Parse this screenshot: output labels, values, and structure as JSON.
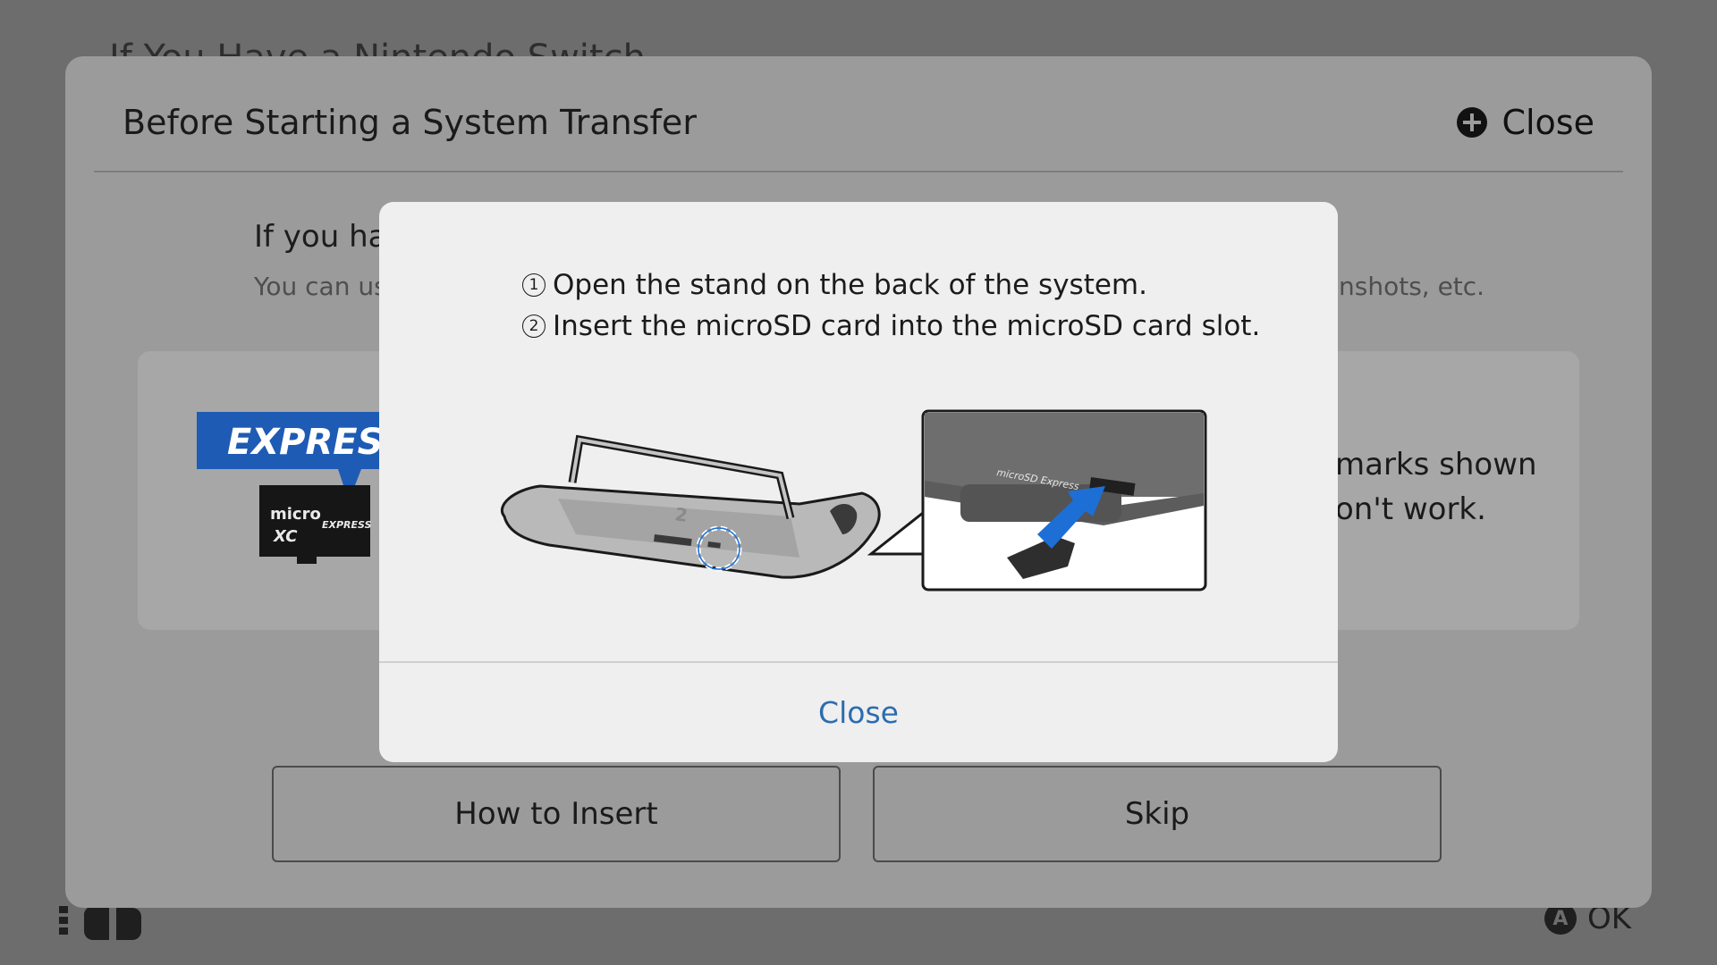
{
  "background": {
    "title": "If You Have a Nintendo Switch"
  },
  "outer_dialog": {
    "title": "Before Starting a System Transfer",
    "close_label": "Close",
    "heading": "If you have",
    "subtext": "You can use",
    "subtext_right": "nshots, etc.",
    "card": {
      "logo_text": "EXPRESS",
      "card_text_line1": "marks shown",
      "card_text_line2": "on't work."
    },
    "buttons": {
      "how_to_insert": "How to Insert",
      "skip": "Skip"
    }
  },
  "modal": {
    "steps": [
      {
        "num": "1",
        "text": "Open the stand on the back of the system."
      },
      {
        "num": "2",
        "text": "Insert the microSD card into the microSD card slot."
      }
    ],
    "illustration": {
      "slot_label": "microSD Express",
      "card_label": "micro SD XC",
      "card_sub_label": "EXPRESS",
      "console_badge": "2"
    },
    "close_label": "Close"
  },
  "footer": {
    "ok_button_glyph": "A",
    "ok_label": "OK"
  },
  "colors": {
    "link_blue": "#2b6cb0",
    "express_blue": "#1e5bb4",
    "arrow_blue": "#1d6fd6"
  }
}
